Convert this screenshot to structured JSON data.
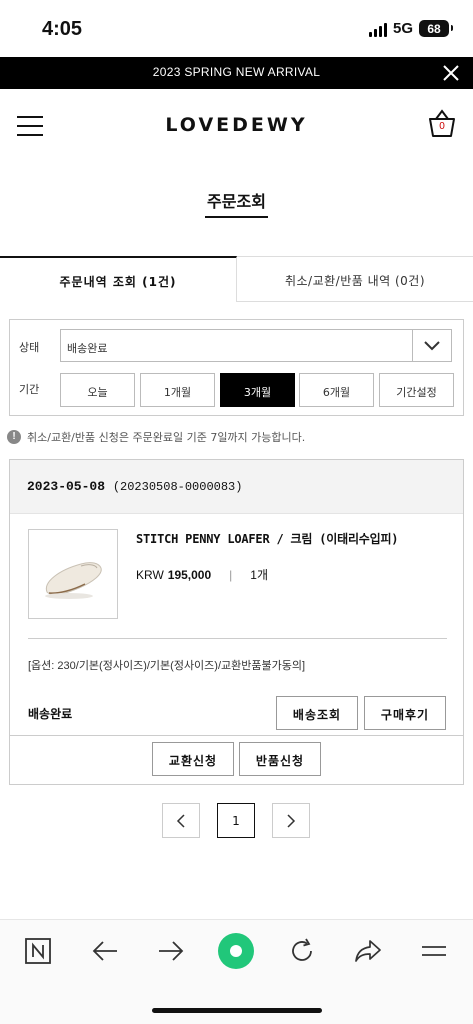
{
  "status_bar": {
    "time": "4:05",
    "network": "5G",
    "battery": "68"
  },
  "promo": {
    "text": "2023 SPRING NEW ARRIVAL"
  },
  "header": {
    "logo": "LOVEDEWY",
    "cart_count": "0"
  },
  "page": {
    "title": "주문조회"
  },
  "tabs": [
    {
      "label": "주문내역 조회 (1건)"
    },
    {
      "label": "취소/교환/반품 내역 (0건)"
    }
  ],
  "filter": {
    "status_label": "상태",
    "status_value": "배송완료",
    "period_label": "기간",
    "periods": [
      "오늘",
      "1개월",
      "3개월",
      "6개월",
      "기간설정"
    ],
    "active_period": "3개월"
  },
  "notice": "취소/교환/반품 신청은 주문완료일 기준 7일까지 가능합니다.",
  "order": {
    "date": "2023-05-08",
    "number": "(20230508-0000083)",
    "product_name": "STITCH PENNY LOAFER / 크림 (이태리수입피)",
    "currency": "KRW",
    "price": "195,000",
    "separator": "|",
    "quantity": "1개",
    "options": "[옵션: 230/기본(정사이즈)/기본(정사이즈)/교환반품불가동의]",
    "status": "배송완료",
    "track_label": "배송조회",
    "review_label": "구매후기",
    "exchange_label": "교환신청",
    "return_label": "반품신청"
  },
  "pagination": {
    "current": "1"
  },
  "colors": {
    "accent_green": "#21c77a",
    "brand_black": "#000000",
    "cart_count": "#cc0000"
  },
  "browser_toolbar": [
    "naver-icon",
    "back-arrow-icon",
    "forward-arrow-icon",
    "green-dot-icon",
    "refresh-icon",
    "share-icon",
    "menu-icon"
  ]
}
